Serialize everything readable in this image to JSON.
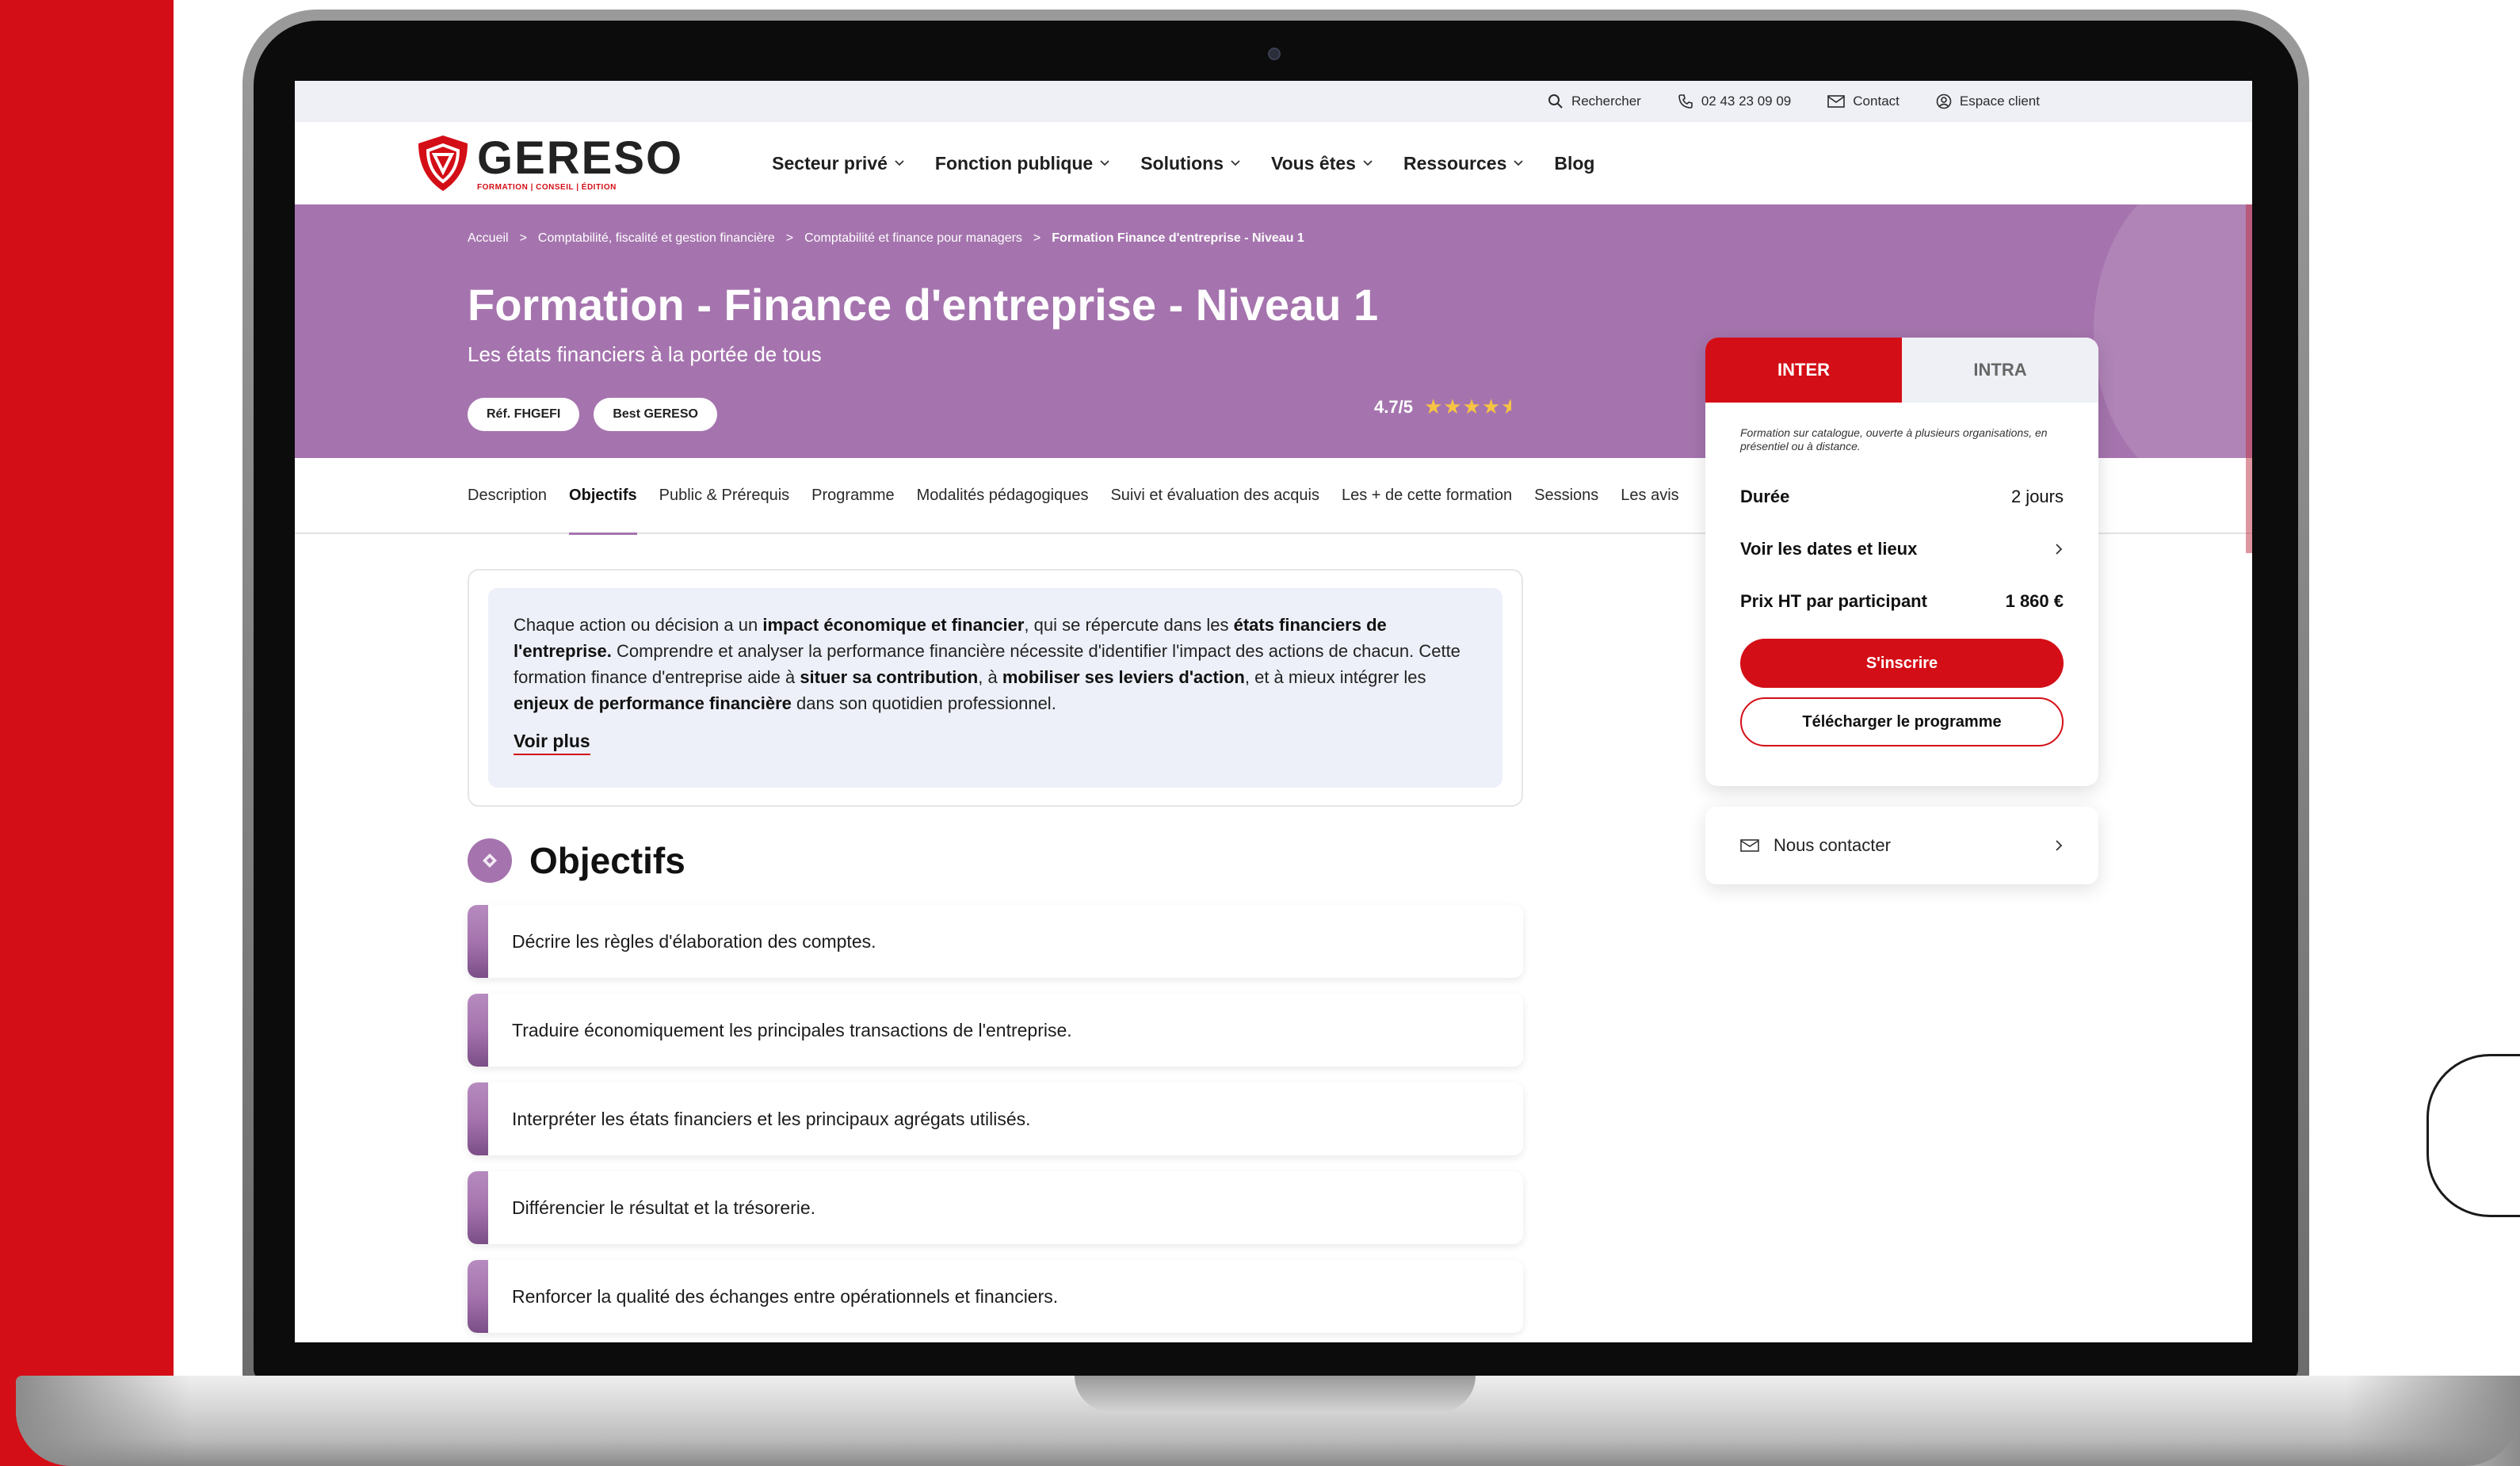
{
  "topbar": {
    "search": "Rechercher",
    "phone": "02 43 23 09 09",
    "contact": "Contact",
    "client": "Espace client"
  },
  "logo": {
    "name": "GERESO",
    "tagline": "FORMATION | CONSEIL | ÉDITION"
  },
  "nav": [
    {
      "label": "Secteur privé",
      "dropdown": true
    },
    {
      "label": "Fonction publique",
      "dropdown": true
    },
    {
      "label": "Solutions",
      "dropdown": true
    },
    {
      "label": "Vous êtes",
      "dropdown": true
    },
    {
      "label": "Ressources",
      "dropdown": true
    },
    {
      "label": "Blog",
      "dropdown": false
    }
  ],
  "breadcrumb": [
    "Accueil",
    "Comptabilité, fiscalité et gestion financière",
    "Comptabilité et finance pour managers",
    "Formation Finance d'entreprise - Niveau 1"
  ],
  "breadcrumb_separator": ">",
  "hero": {
    "title": "Formation - Finance d'entreprise - Niveau 1",
    "subtitle": "Les états financiers à la portée de tous",
    "badge_ref": "Réf. FHGEFI",
    "badge_best": "Best GERESO",
    "rating": "4.7/5",
    "stars": 4.5
  },
  "tabs": [
    {
      "label": "Description",
      "active": false
    },
    {
      "label": "Objectifs",
      "active": true
    },
    {
      "label": "Public & Prérequis",
      "active": false
    },
    {
      "label": "Programme",
      "active": false
    },
    {
      "label": "Modalités pédagogiques",
      "active": false
    },
    {
      "label": "Suivi et évaluation des acquis",
      "active": false
    },
    {
      "label": "Les + de cette formation",
      "active": false
    },
    {
      "label": "Sessions",
      "active": false
    },
    {
      "label": "Les avis",
      "active": false
    }
  ],
  "intro": {
    "p1": "Chaque action ou décision a un ",
    "b1": "impact économique et financier",
    "p2": ", qui se répercute dans les ",
    "b2": "états financiers de l'entreprise.",
    "p3": " Comprendre et analyser la performance financière nécessite d'identifier l'impact des actions de chacun. Cette formation finance d'entreprise aide à ",
    "b3": "situer sa contribution",
    "p4": ", à ",
    "b4": "mobiliser ses leviers d'action",
    "p5": ", et à mieux intégrer les ",
    "b5": "enjeux de performance financière",
    "p6": " dans son quotidien professionnel.",
    "more": "Voir plus"
  },
  "objectives": {
    "title": "Objectifs",
    "items": [
      "Décrire les règles d'élaboration des comptes.",
      "Traduire économiquement les principales transactions de l'entreprise.",
      "Interpréter les états financiers et les principaux agrégats utilisés.",
      "Différencier le résultat et la trésorerie.",
      "Renforcer la qualité des échanges entre opérationnels et financiers."
    ]
  },
  "sidecard": {
    "tab_inter": "INTER",
    "tab_intra": "INTRA",
    "note": "Formation sur catalogue, ouverte à plusieurs organisations, en présentiel ou à distance.",
    "duree_label": "Durée",
    "duree_value": "2 jours",
    "dates_label": "Voir les dates et lieux",
    "prix_label": "Prix HT par participant",
    "prix_value": "1 860 €",
    "btn_inscrire": "S'inscrire",
    "btn_telecharger": "Télécharger le programme"
  },
  "contact_card": {
    "label": "Nous contacter"
  },
  "colors": {
    "brand_red": "#d40e16",
    "brand_purple": "#a574ae",
    "topbar_bg": "#eef0f6",
    "star": "#f6c344"
  }
}
